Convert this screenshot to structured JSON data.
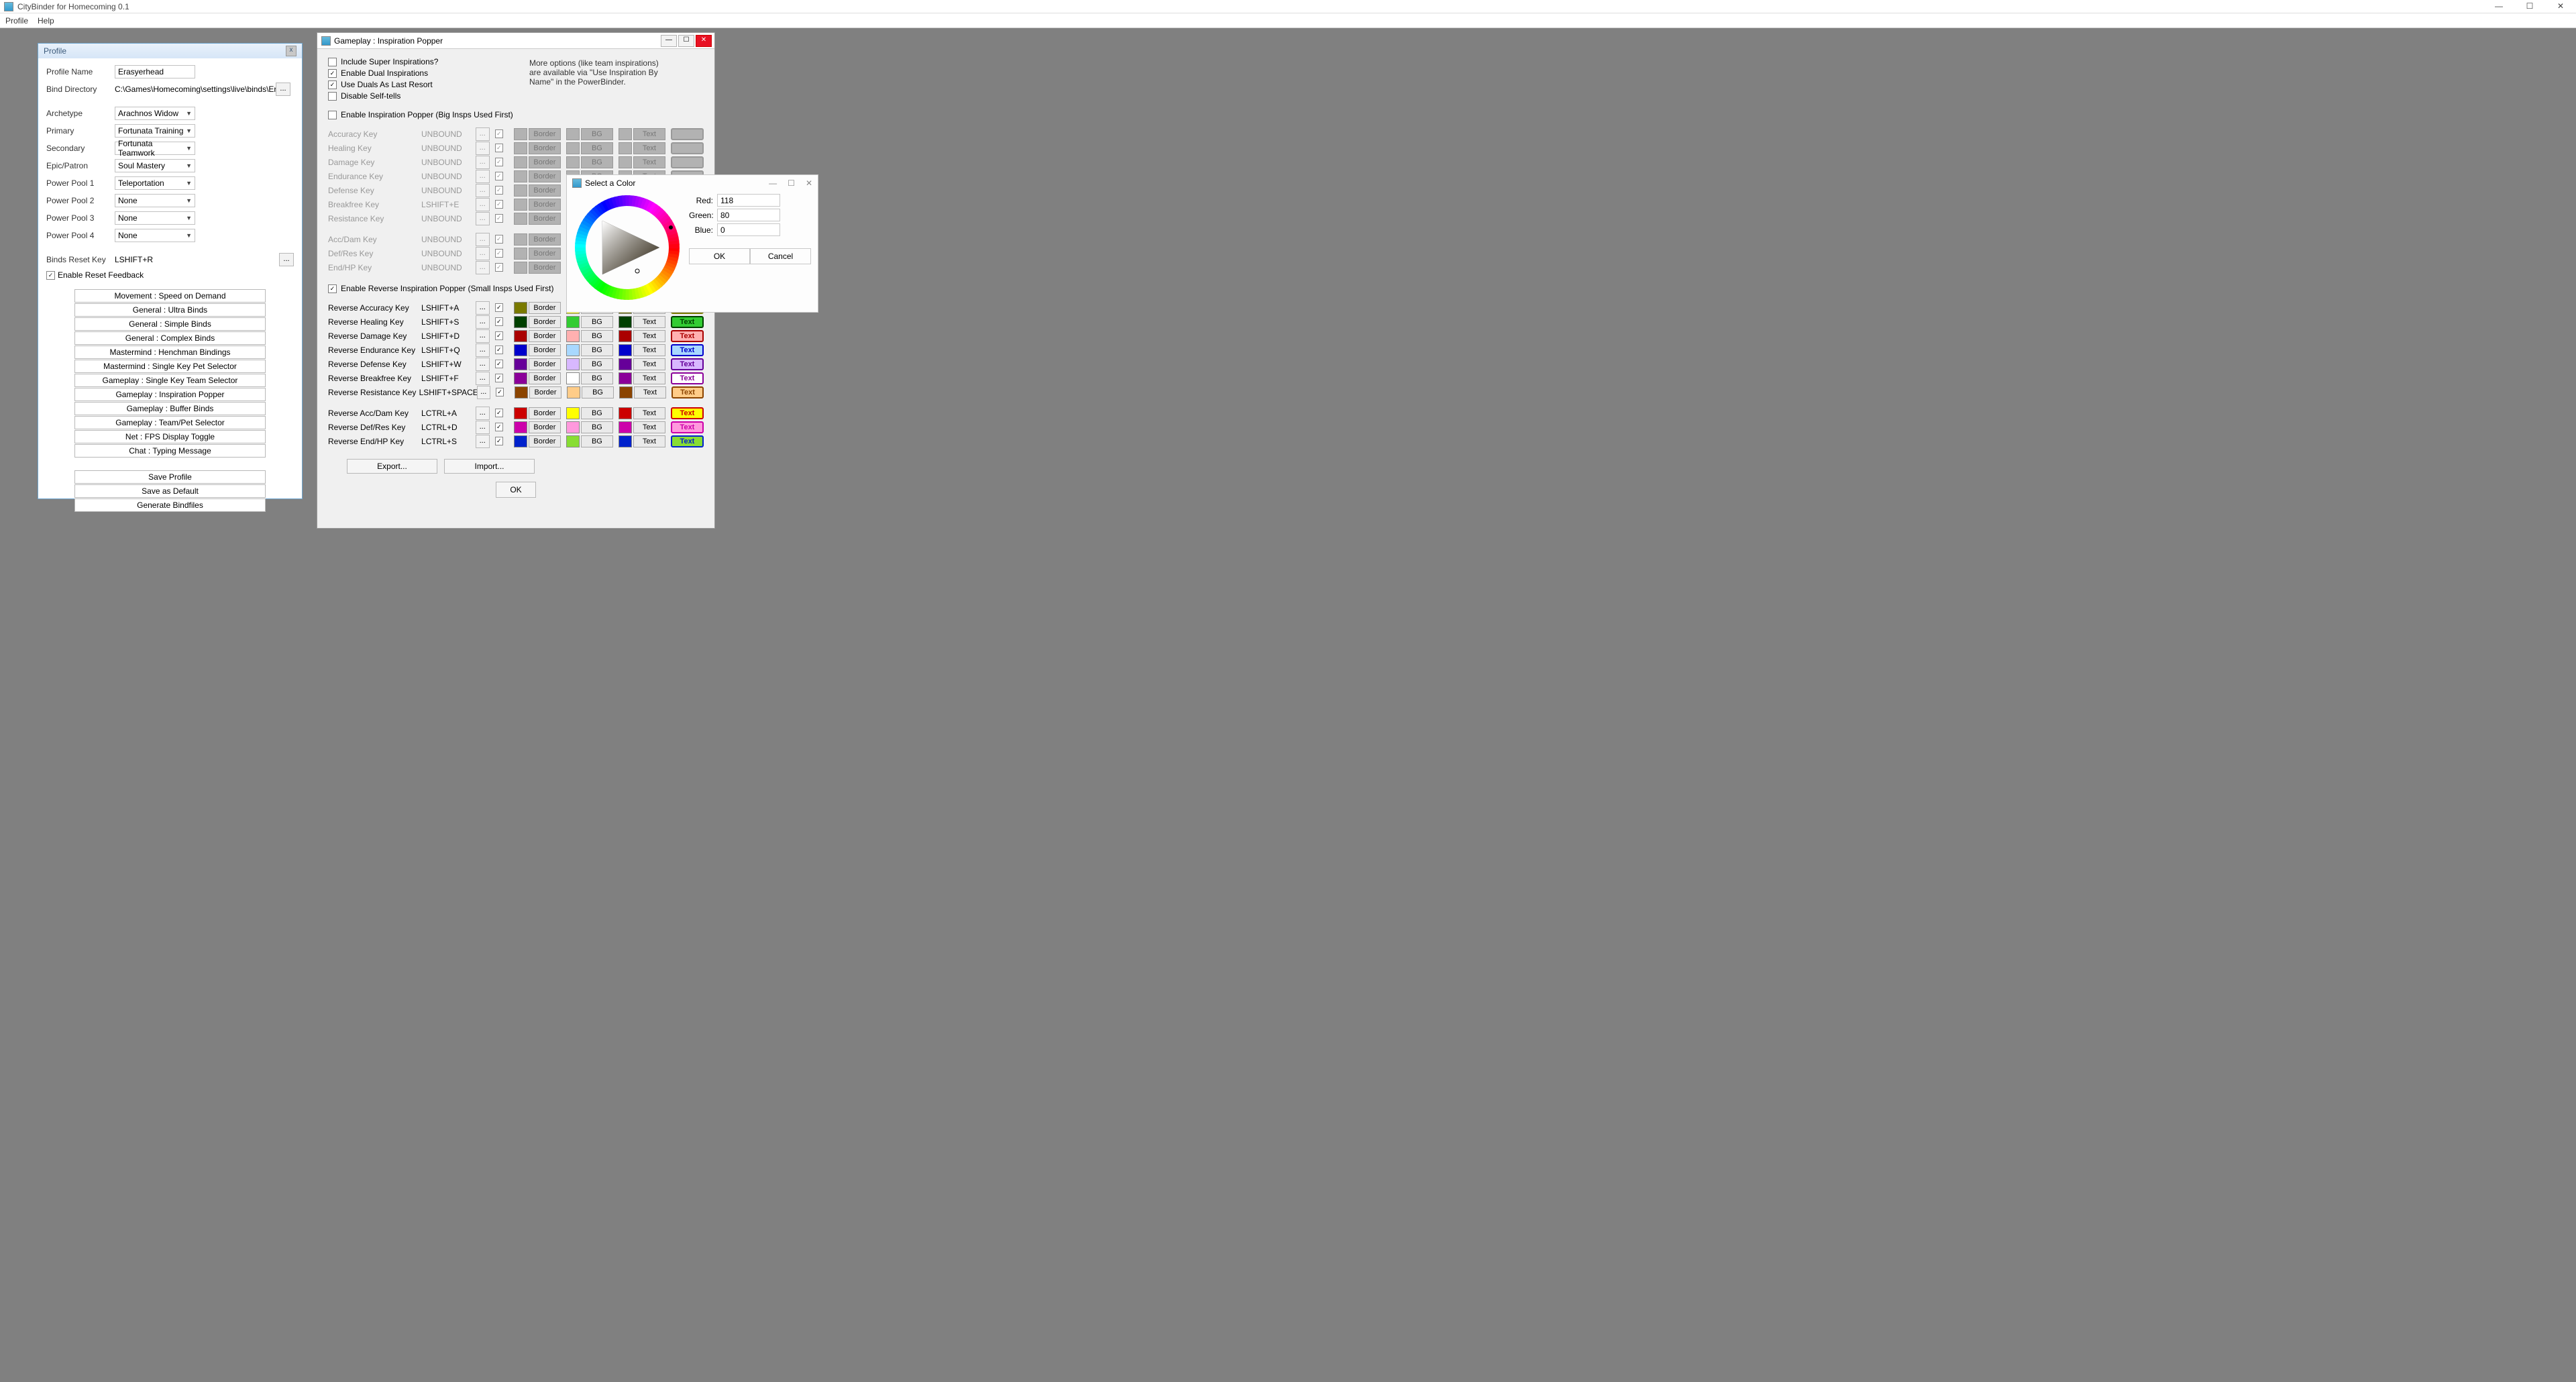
{
  "app": {
    "title": "CityBinder for Homecoming 0.1"
  },
  "menu": [
    "Profile",
    "Help"
  ],
  "profile": {
    "title": "Profile",
    "name_label": "Profile Name",
    "name_value": "Erasyerhead",
    "binddir_label": "Bind Directory",
    "binddir_value": "C:\\Games\\Homecoming\\settings\\live\\binds\\Erasyer",
    "fields": [
      {
        "label": "Archetype",
        "value": "Arachnos Widow"
      },
      {
        "label": "Primary",
        "value": "Fortunata Training"
      },
      {
        "label": "Secondary",
        "value": "Fortunata Teamwork"
      },
      {
        "label": "Epic/Patron",
        "value": "Soul Mastery"
      },
      {
        "label": "Power Pool 1",
        "value": "Teleportation"
      },
      {
        "label": "Power Pool 2",
        "value": "None"
      },
      {
        "label": "Power Pool 3",
        "value": "None"
      },
      {
        "label": "Power Pool 4",
        "value": "None"
      }
    ],
    "reset_label": "Binds Reset Key",
    "reset_value": "LSHIFT+R",
    "reset_feedback": "Enable Reset Feedback",
    "modules": [
      "Movement : Speed on Demand",
      "General : Ultra Binds",
      "General : Simple Binds",
      "General : Complex Binds",
      "Mastermind : Henchman Bindings",
      "Mastermind : Single Key Pet Selector",
      "Gameplay : Single Key Team Selector",
      "Gameplay : Inspiration Popper",
      "Gameplay : Buffer Binds",
      "Gameplay : Team/Pet Selector",
      "Net : FPS Display Toggle",
      "Chat : Typing Message"
    ],
    "actions": [
      "Save Profile",
      "Save as Default",
      "Generate Bindfiles"
    ]
  },
  "gameplay": {
    "title": "Gameplay : Inspiration Popper",
    "opts": [
      {
        "label": "Include Super Inspirations?",
        "checked": false
      },
      {
        "label": "Enable Dual Inspirations",
        "checked": true
      },
      {
        "label": "Use Duals As Last Resort",
        "checked": true
      },
      {
        "label": "Disable Self-tells",
        "checked": false
      }
    ],
    "moreopt": "More options (like team inspirations) are available via \"Use Inspiration By Name\" in the PowerBinder.",
    "section1_label": "Enable Inspiration Popper (Big Insps Used First)",
    "forward": [
      {
        "label": "Accuracy Key",
        "val": "UNBOUND"
      },
      {
        "label": "Healing Key",
        "val": "UNBOUND"
      },
      {
        "label": "Damage Key",
        "val": "UNBOUND"
      },
      {
        "label": "Endurance Key",
        "val": "UNBOUND"
      },
      {
        "label": "Defense Key",
        "val": "UNBOUND"
      },
      {
        "label": "Breakfree Key",
        "val": "LSHIFT+E"
      },
      {
        "label": "Resistance Key",
        "val": "UNBOUND"
      }
    ],
    "forward2": [
      {
        "label": "Acc/Dam Key",
        "val": "UNBOUND"
      },
      {
        "label": "Def/Res Key",
        "val": "UNBOUND"
      },
      {
        "label": "End/HP Key",
        "val": "UNBOUND"
      }
    ],
    "section2_label": "Enable Reverse Inspiration Popper (Small Insps Used First)",
    "reverse": [
      {
        "label": "Reverse Accuracy Key",
        "val": "LSHIFT+A",
        "border": "#7a7a00",
        "bg": "#ffff00",
        "text": "#7a7a00",
        "preview_bg": "#ffff00",
        "preview_border": "#7a7a00",
        "preview_fg": "#7a7a00"
      },
      {
        "label": "Reverse Healing Key",
        "val": "LSHIFT+S",
        "border": "#004000",
        "bg": "#33cc33",
        "text": "#004000",
        "preview_bg": "#33cc33",
        "preview_border": "#004000",
        "preview_fg": "#004000"
      },
      {
        "label": "Reverse Damage Key",
        "val": "LSHIFT+D",
        "border": "#aa0000",
        "bg": "#ffb0b0",
        "text": "#aa0000",
        "preview_bg": "#ffb0b0",
        "preview_border": "#aa0000",
        "preview_fg": "#aa0000"
      },
      {
        "label": "Reverse Endurance Key",
        "val": "LSHIFT+Q",
        "border": "#0000cc",
        "bg": "#a8d8ff",
        "text": "#0000cc",
        "preview_bg": "#a8d8ff",
        "preview_border": "#0000cc",
        "preview_fg": "#0000cc"
      },
      {
        "label": "Reverse Defense Key",
        "val": "LSHIFT+W",
        "border": "#660099",
        "bg": "#d8b8ff",
        "text": "#660099",
        "preview_bg": "#d8b8ff",
        "preview_border": "#660099",
        "preview_fg": "#660099"
      },
      {
        "label": "Reverse Breakfree Key",
        "val": "LSHIFT+F",
        "border": "#8b0099",
        "bg": "#ffffff",
        "text": "#8b0099",
        "preview_bg": "#ffffff",
        "preview_border": "#8b0099",
        "preview_fg": "#8b0099"
      },
      {
        "label": "Reverse Resistance Key",
        "val": "LSHIFT+SPACE",
        "border": "#8b4400",
        "bg": "#ffcc88",
        "text": "#8b4400",
        "preview_bg": "#ffcc88",
        "preview_border": "#8b4400",
        "preview_fg": "#8b4400"
      }
    ],
    "reverse2": [
      {
        "label": "Reverse Acc/Dam Key",
        "val": "LCTRL+A",
        "border": "#cc0000",
        "bg": "#ffff00",
        "text": "#cc0000",
        "preview_bg": "#ffff00",
        "preview_border": "#cc0000",
        "preview_fg": "#cc0000"
      },
      {
        "label": "Reverse Def/Res Key",
        "val": "LCTRL+D",
        "border": "#cc00aa",
        "bg": "#ff99dd",
        "text": "#cc00aa",
        "preview_bg": "#ff99dd",
        "preview_border": "#cc00aa",
        "preview_fg": "#cc00aa"
      },
      {
        "label": "Reverse End/HP Key",
        "val": "LCTRL+S",
        "border": "#0022cc",
        "bg": "#88dd33",
        "text": "#0022cc",
        "preview_bg": "#88dd33",
        "preview_border": "#0022cc",
        "preview_fg": "#0022cc"
      }
    ],
    "border_label": "Border",
    "bg_label": "BG",
    "text_label": "Text",
    "preview_label": "Text",
    "export": "Export...",
    "import": "Import...",
    "ok": "OK"
  },
  "colorpicker": {
    "title": "Select a Color",
    "red_label": "Red:",
    "green_label": "Green:",
    "blue_label": "Blue:",
    "red": "118",
    "green": "80",
    "blue": "0",
    "ok": "OK",
    "cancel": "Cancel"
  }
}
